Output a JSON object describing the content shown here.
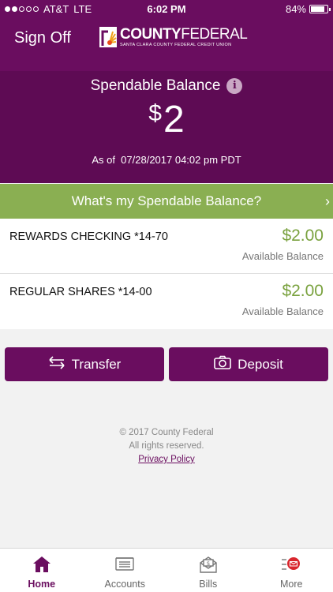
{
  "status": {
    "carrier": "AT&T",
    "network": "LTE",
    "time": "6:02 PM",
    "battery": "84%",
    "battery_level": 0.84
  },
  "header": {
    "signoff_label": "Sign Off",
    "logo_name_bold": "COUNTY",
    "logo_name_light": "FEDERAL",
    "logo_subtitle": "SANTA CLARA COUNTY FEDERAL CREDIT UNION"
  },
  "balance": {
    "title": "Spendable Balance",
    "info_icon": "i",
    "currency": "$",
    "amount": "2",
    "as_of_label": "As of",
    "as_of_value": "07/28/2017 04:02 pm PDT"
  },
  "banner": {
    "label": "What's my Spendable Balance?",
    "chevron": "›"
  },
  "accounts": [
    {
      "name": "REWARDS CHECKING *14-70",
      "amount": "$2.00",
      "balance_label": "Available Balance"
    },
    {
      "name": "REGULAR SHARES *14-00",
      "amount": "$2.00",
      "balance_label": "Available Balance"
    }
  ],
  "actions": {
    "transfer_label": "Transfer",
    "deposit_label": "Deposit"
  },
  "footer": {
    "copyright": "© 2017 County Federal",
    "rights": "All rights reserved.",
    "privacy_link": "Privacy Policy"
  },
  "tabs": [
    {
      "label": "Home",
      "icon": "home-icon",
      "active": true
    },
    {
      "label": "Accounts",
      "icon": "accounts-icon",
      "active": false
    },
    {
      "label": "Bills",
      "icon": "bills-icon",
      "active": false
    },
    {
      "label": "More",
      "icon": "more-icon",
      "active": false
    }
  ],
  "colors": {
    "brand_purple": "#6a0d5f",
    "banner_green": "#8aaf52",
    "amount_green": "#7aa23f"
  }
}
